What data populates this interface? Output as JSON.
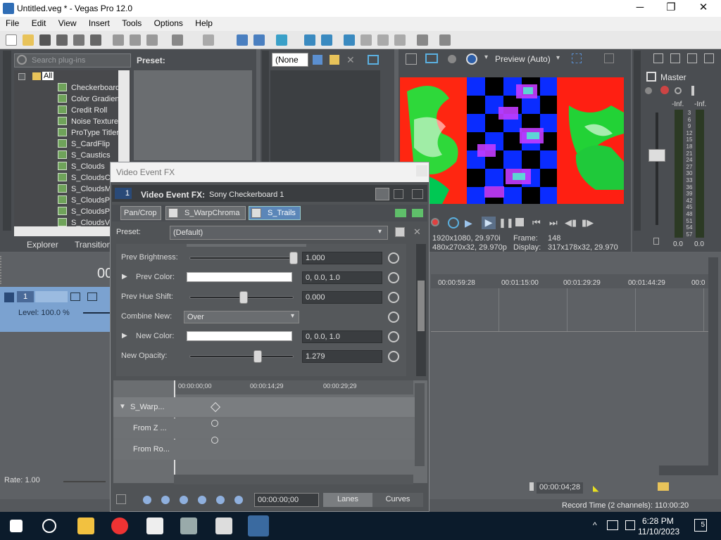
{
  "window": {
    "title": "Untitled.veg * - Vegas Pro 12.0",
    "minimize": "─",
    "maximize": "❐",
    "close": "✕"
  },
  "menu": [
    "File",
    "Edit",
    "View",
    "Insert",
    "Tools",
    "Options",
    "Help"
  ],
  "plugins": {
    "search_placeholder": "Search plug-ins",
    "root": "All",
    "items": [
      "Checkerboard",
      "Color Gradient",
      "Credit Roll",
      "Noise Texture",
      "ProType Titler",
      "S_CardFlip",
      "S_Caustics",
      "S_Clouds",
      "S_CloudsColorS",
      "S_CloudsMultCo",
      "S_CloudsPerspe",
      "S_CloudsPsyko",
      "S_CloudsVortex"
    ],
    "preset_label": "Preset:",
    "tabs": [
      "Explorer",
      "Transitions"
    ]
  },
  "trimmer": {
    "dropdown": "(None"
  },
  "preview": {
    "mode": "Preview (Auto)",
    "frame_label": "Frame:",
    "frame_value": "148",
    "project_line1": "1920x1080, 29.970i",
    "project_line2": "480x270x32, 29.970p",
    "display_label": "Display:",
    "display_value": "317x178x32, 29.970"
  },
  "master": {
    "title": "Master",
    "inf_left": "-Inf.",
    "inf_right": "-Inf.",
    "scale": [
      "3",
      "6",
      "9",
      "12",
      "15",
      "18",
      "21",
      "24",
      "27",
      "30",
      "33",
      "36",
      "39",
      "42",
      "45",
      "48",
      "51",
      "54",
      "57"
    ],
    "bottom_left": "0.0",
    "bottom_right": "0.0"
  },
  "timeline": {
    "track_number": "1",
    "level": "Level: 100.0 %",
    "time_partial": "00",
    "ruler": [
      "00:00:59:28",
      "00:01:15:00",
      "00:01:29:29",
      "00:01:44:29",
      "00:0"
    ],
    "rate": "Rate: 1.00",
    "cursor_time": "00:00:04;28",
    "record_time": "Record Time (2 channels): 110:00:20"
  },
  "fx_dialog": {
    "title": "Video Event FX",
    "header_prefix": "Video Event FX:",
    "header_name": "Sony Checkerboard 1",
    "chain": [
      "Pan/Crop",
      "S_WarpChroma",
      "S_Trails"
    ],
    "preset_label": "Preset:",
    "preset_value": "(Default)",
    "params": [
      {
        "label": "Prev Brightness:",
        "value": "1.000",
        "kind": "slider",
        "level": 1.0
      },
      {
        "label": "Prev Color:",
        "value": "0, 0.0, 1.0",
        "kind": "color"
      },
      {
        "label": "Prev Hue Shift:",
        "value": "0.000",
        "kind": "slider",
        "level": 0.5
      },
      {
        "label": "Combine New:",
        "value": "Over",
        "kind": "select"
      },
      {
        "label": "New Color:",
        "value": "0, 0.0, 1.0",
        "kind": "color"
      },
      {
        "label": "New Opacity:",
        "value": "1.279",
        "kind": "slider",
        "level": 0.64
      }
    ],
    "kf_ruler": [
      "00:00:00;00",
      "00:00:14;29",
      "00:00:29;29"
    ],
    "kf_tracks": [
      "S_Warp...",
      "From Z ...",
      "From Ro..."
    ],
    "time_value": "00:00:00;00",
    "lanes_label": "Lanes",
    "curves_label": "Curves"
  },
  "taskbar": {
    "time": "6:28 PM",
    "date": "11/10/2023",
    "notif_count": "5"
  },
  "colors": {
    "accent": "#5b9bd5",
    "taskbar": "#0b1b2b",
    "panel": "#4a4d51"
  }
}
